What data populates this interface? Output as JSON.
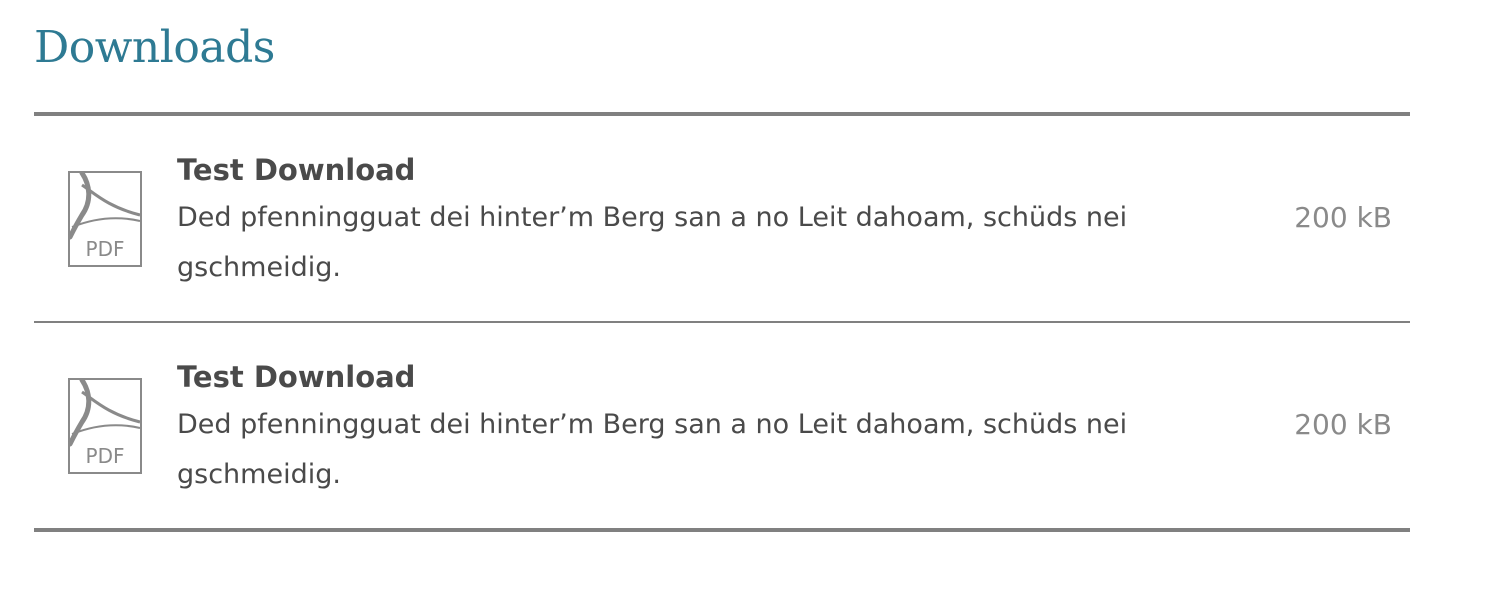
{
  "page": {
    "title": "Downloads"
  },
  "downloads": [
    {
      "title": "Test Download",
      "description": "Ded pfenningguat dei hinter’m Berg san a no Leit dahoam, schüds nei gschmeidig.",
      "size": "200 kB",
      "icon": "pdf-icon",
      "icon_label": "PDF"
    },
    {
      "title": "Test Download",
      "description": "Ded pfenningguat dei hinter’m Berg san a no Leit dahoam, schüds nei gschmeidig.",
      "size": "200 kB",
      "icon": "pdf-icon",
      "icon_label": "PDF"
    }
  ],
  "colors": {
    "title": "#2e7a93",
    "text": "#4a4a4a",
    "muted": "#8a8a8a",
    "divider": "#808080"
  }
}
